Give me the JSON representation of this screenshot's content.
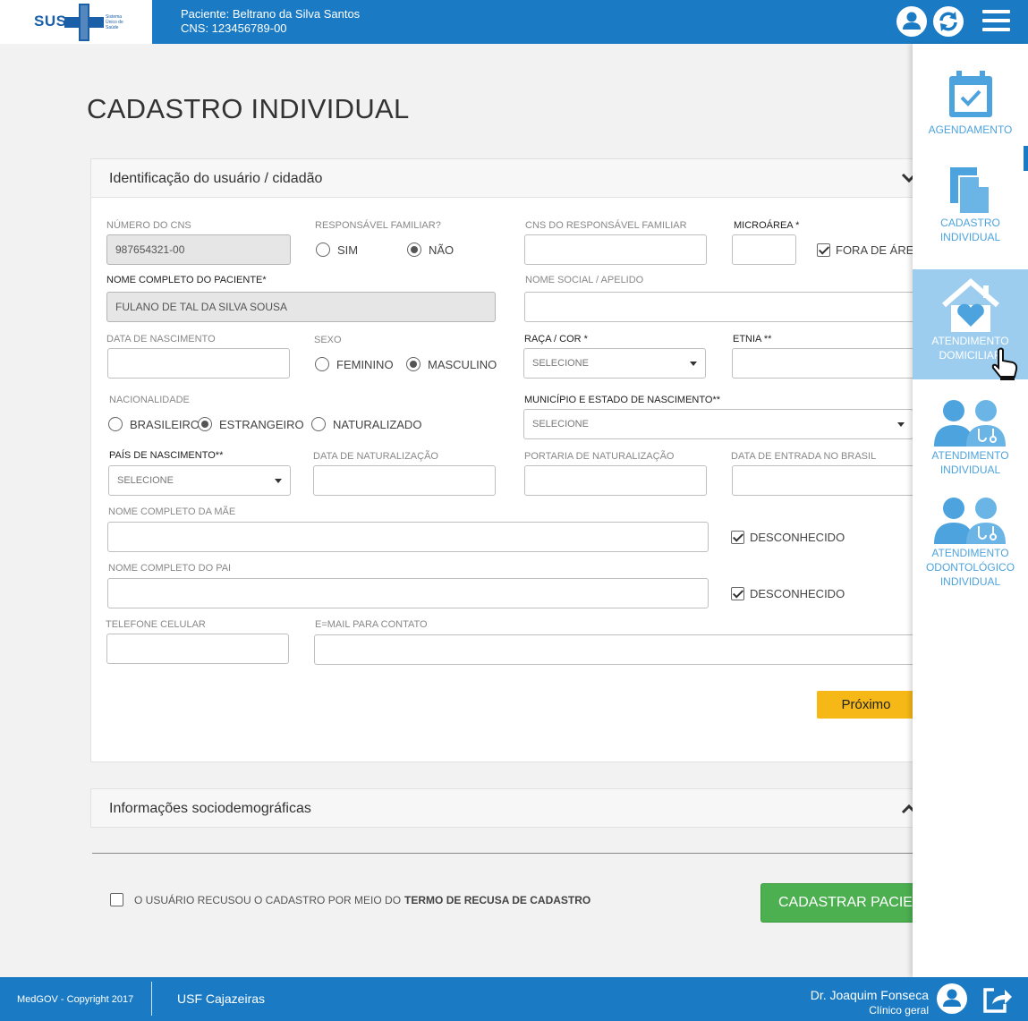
{
  "header": {
    "logo_text": "SUS",
    "logo_small": "Sistema Único de Saúde",
    "patient_line": "Paciente: Beltrano da Silva Santos",
    "cns_line": "CNS: 123456789-00"
  },
  "page_title": "CADASTRO INDIVIDUAL",
  "section1": {
    "title": "Identificação do usuário / cidadão",
    "cns_label": "NÚMERO DO CNS",
    "cns_value": "987654321-00",
    "resp_label": "RESPONSÁVEL FAMILIAR?",
    "resp_options": [
      "SIM",
      "NÃO"
    ],
    "cns_resp_label": "CNS DO RESPONSÁVEL FAMILIAR",
    "microarea_label": "MICROÁREA *",
    "fora_area_label": "FORA DE ÁREA",
    "nome_label": "NOME COMPLETO DO PACIENTE*",
    "nome_value": "FULANO DE TAL DA SILVA SOUSA",
    "nome_social_label": "NOME SOCIAL / APELIDO",
    "nascimento_label": "DATA DE NASCIMENTO",
    "sexo_label": "SEXO",
    "sexo_options": [
      "FEMININO",
      "MASCULINO"
    ],
    "raca_label": "RAÇA / COR *",
    "raca_value": "SELECIONE",
    "etnia_label": "ETNIA **",
    "nacionalidade_label": "NACIONALIDADE",
    "nacionalidade_options": [
      "BRASILEIRO",
      "ESTRANGEIRO",
      "NATURALIZADO"
    ],
    "municipio_label": "MUNICÍPIO E ESTADO DE NASCIMENTO**",
    "municipio_value": "SELECIONE",
    "pais_label": "PAÍS DE NASCIMENTO**",
    "pais_value": "SELECIONE",
    "data_nat_label": "DATA DE NATURALIZAÇÃO",
    "portaria_label": "PORTARIA DE NATURALIZAÇÃO",
    "entrada_label": "DATA DE ENTRADA NO BRASIL",
    "mae_label": "NOME COMPLETO DA MÃE",
    "pai_label": "NOME COMPLETO DO PAI",
    "desconhecido_label": "DESCONHECIDO",
    "telefone_label": "TELEFONE CELULAR",
    "email_label": "E=MAIL PARA CONTATO",
    "next_button": "Próximo"
  },
  "section2": {
    "title": "Informações sociodemográficas"
  },
  "refuse": {
    "text": "O USUÁRIO RECUSOU O CADASTRO POR MEIO DO",
    "bold": "TERMO DE RECUSA DE CADASTRO"
  },
  "submit_button": "CADASTRAR PACIENTE",
  "sidebar": {
    "items": [
      {
        "label": "AGENDAMENTO"
      },
      {
        "label": "CADASTRO INDIVIDUAL"
      },
      {
        "label": "ATENDIMENTO DOMICILIAR"
      },
      {
        "label": "ATENDIMENTO INDIVIDUAL"
      },
      {
        "label": "ATENDIMENTO ODONTOLÓGICO INDIVIDUAL"
      }
    ]
  },
  "footer": {
    "copyright": "MedGOV - Copyright 2017",
    "unit": "USF Cajazeiras",
    "doctor": "Dr. Joaquim Fonseca",
    "specialty": "Clínico geral"
  },
  "colors": {
    "brand_blue": "#1a7bc4",
    "next_yellow": "#f6b817",
    "submit_green": "#4caf50",
    "sidebar_active": "#9dcdee",
    "sidebar_text": "#4da3dd"
  }
}
